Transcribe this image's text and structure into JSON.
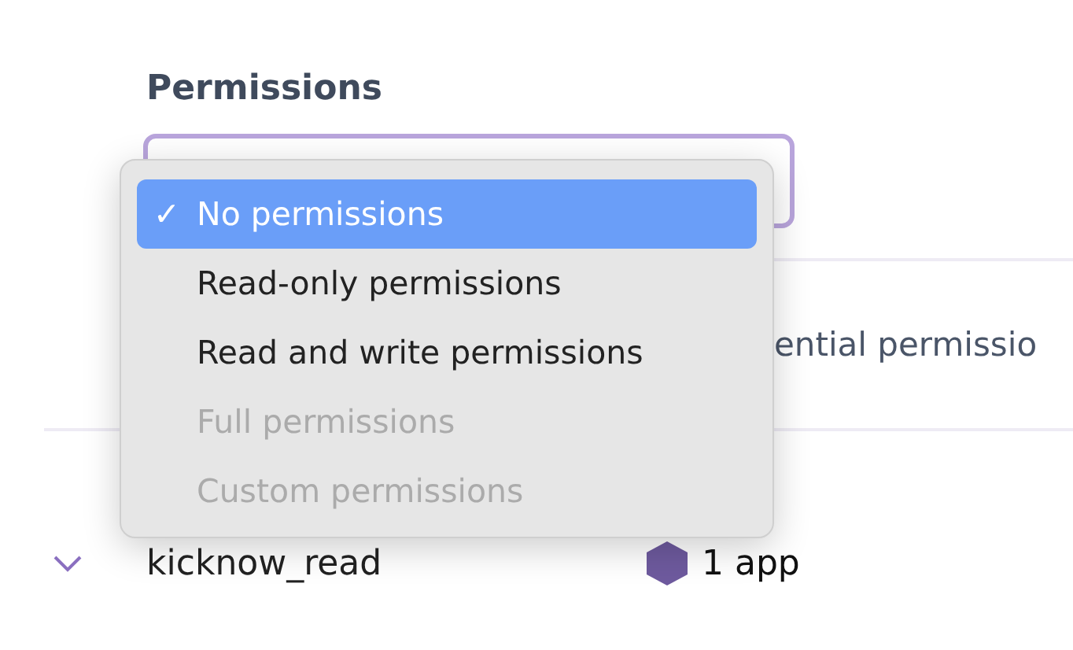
{
  "section_label": "Permissions",
  "menu": {
    "check_mark": "✓",
    "items": [
      {
        "label": "No permissions",
        "selected": true,
        "disabled": false
      },
      {
        "label": "Read-only permissions",
        "selected": false,
        "disabled": false
      },
      {
        "label": "Read and write permissions",
        "selected": false,
        "disabled": false
      },
      {
        "label": "Full permissions",
        "selected": false,
        "disabled": true
      },
      {
        "label": "Custom permissions",
        "selected": false,
        "disabled": true
      }
    ]
  },
  "partial_text": "ential permissio",
  "credential_row": {
    "name": "kicknow_read",
    "apps": "1 app"
  }
}
